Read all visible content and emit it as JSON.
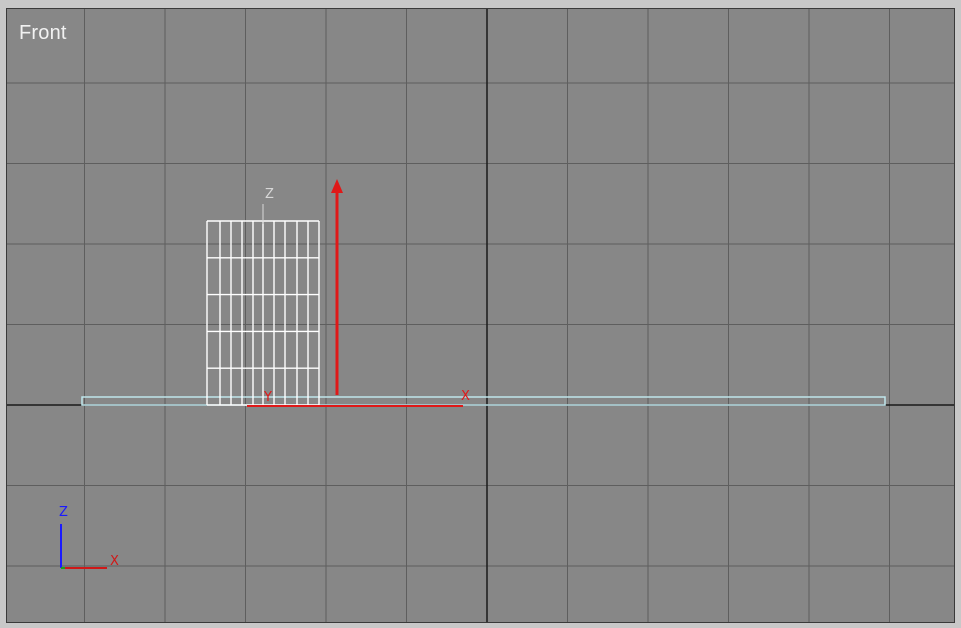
{
  "viewport": {
    "label": "Front",
    "background": "#878787",
    "grid_color": "#5e5e5e",
    "home_grid_color": "#1a1a1a"
  },
  "object": {
    "type": "cylinder",
    "wire_color": "#ffffff",
    "pivot_axis_label": "Z"
  },
  "plane": {
    "type": "plane",
    "wire_color": "#bfe6ec"
  },
  "gizmo": {
    "color": "#e01818",
    "x_label": "X",
    "y_label": "Y"
  },
  "axis_tripod": {
    "z_label": "Z",
    "x_label": "X",
    "z_color": "#1a1aff",
    "x_color": "#d01818",
    "y_color": "#1aa01a"
  }
}
